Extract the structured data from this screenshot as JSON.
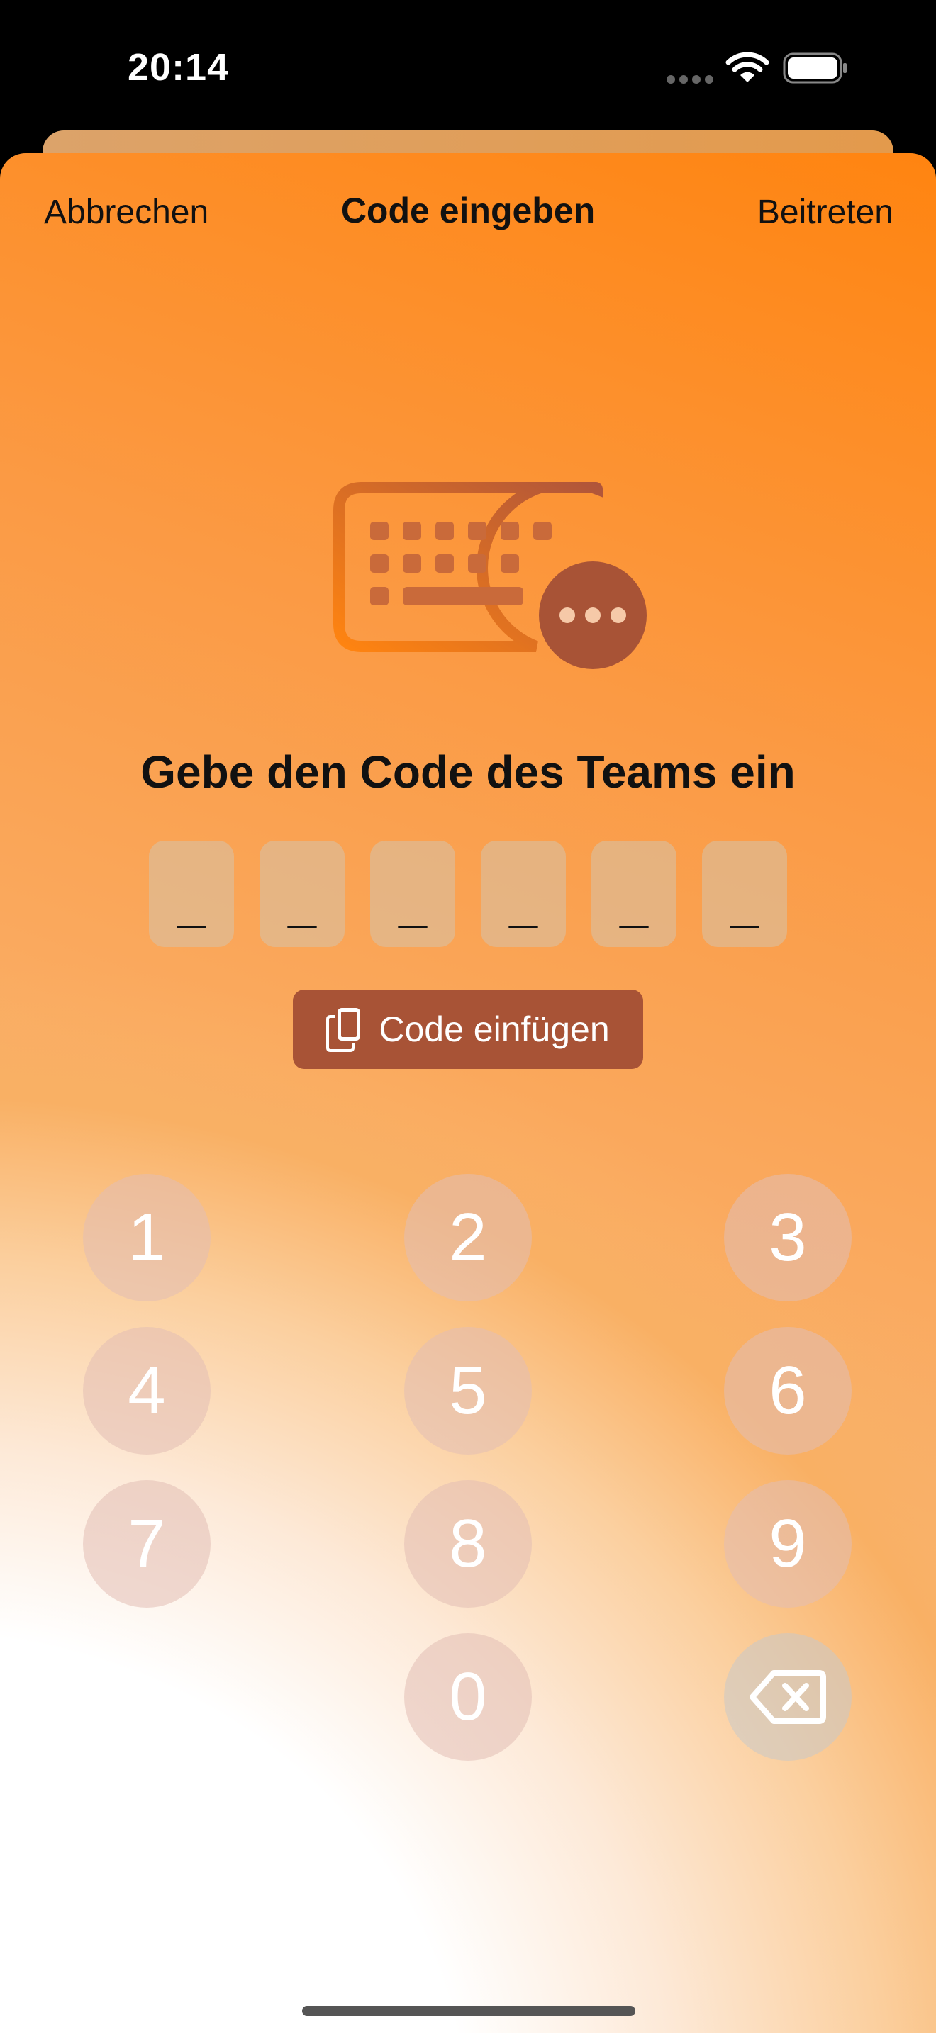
{
  "status_bar": {
    "time": "20:14",
    "icons": [
      "signal-dots-icon",
      "wifi-icon",
      "battery-icon"
    ]
  },
  "nav": {
    "cancel_label": "Abbrechen",
    "title": "Code eingeben",
    "join_label": "Beitreten"
  },
  "hero": {
    "icon": "keyboard-ellipsis-icon",
    "heading": "Gebe den Code des Teams ein"
  },
  "code": {
    "slots": [
      "_",
      "_",
      "_",
      "_",
      "_",
      "_"
    ]
  },
  "paste": {
    "icon": "clipboard-phone-icon",
    "label": "Code einfügen"
  },
  "keypad": {
    "keys": [
      "1",
      "2",
      "3",
      "4",
      "5",
      "6",
      "7",
      "8",
      "9",
      "0"
    ],
    "delete_icon": "delete-backward-icon"
  },
  "colors": {
    "accent": "#a85336",
    "gradient_orange": "#ff8410",
    "key_fill": "#e1beb4"
  }
}
